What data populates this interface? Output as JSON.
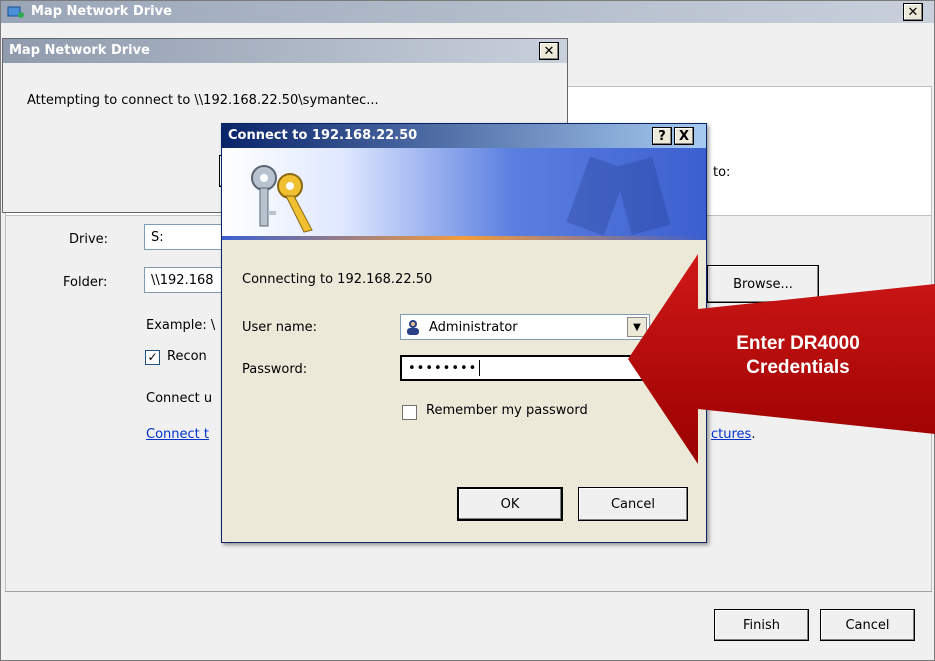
{
  "back_window": {
    "title": "Map Network Drive",
    "drive_label": "Drive:",
    "drive_value": "S:",
    "folder_label": "Folder:",
    "folder_value": "\\\\192.168",
    "browse_label": "Browse...",
    "example_text": "Example: \\",
    "reconnect_label": "Recon",
    "connect_using_text": "Connect u",
    "connect_link_text": "Connect t",
    "pictures_link_tail": "ctures",
    "to_text": "to:",
    "finish_label": "Finish",
    "cancel_label": "Cancel"
  },
  "progress_dialog": {
    "title": "Map Network Drive",
    "message": "Attempting to connect to \\\\192.168.22.50\\symantec..."
  },
  "login_dialog": {
    "title": "Connect to 192.168.22.50",
    "connecting_text": "Connecting to 192.168.22.50",
    "username_label": "User name:",
    "username_value": "Administrator",
    "password_label": "Password:",
    "password_value": "••••••••",
    "remember_label": "Remember my password",
    "ok_label": "OK",
    "cancel_label": "Cancel",
    "help_glyph": "?",
    "close_glyph": "X"
  },
  "annotation": {
    "text_line1": "Enter DR4000",
    "text_line2": "Credentials",
    "color": "#c00000"
  }
}
